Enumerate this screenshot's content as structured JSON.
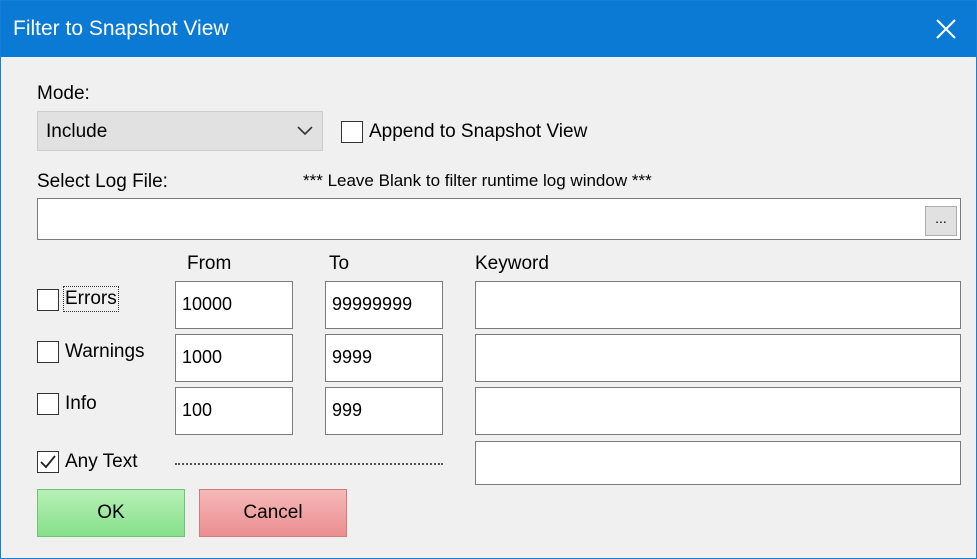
{
  "window": {
    "title": "Filter to Snapshot View",
    "close_glyph": "close-icon"
  },
  "mode": {
    "label": "Mode:",
    "selected": "Include",
    "append_label": "Append to Snapshot View",
    "append_checked": false
  },
  "log_file": {
    "label": "Select Log File:",
    "hint": "*** Leave Blank to filter runtime log window ***",
    "value": "",
    "browse_label": "..."
  },
  "columns": {
    "from": "From",
    "to": "To",
    "keyword": "Keyword"
  },
  "filters": [
    {
      "label": "Errors",
      "checked": false,
      "from": "10000",
      "to": "99999999",
      "keyword": ""
    },
    {
      "label": "Warnings",
      "checked": false,
      "from": "1000",
      "to": "9999",
      "keyword": ""
    },
    {
      "label": "Info",
      "checked": false,
      "from": "100",
      "to": "999",
      "keyword": ""
    }
  ],
  "any_text": {
    "label": "Any Text",
    "checked": true,
    "keyword": ""
  },
  "buttons": {
    "ok": "OK",
    "cancel": "Cancel"
  },
  "colors": {
    "titlebar": "#0a7ad4",
    "ok_button": "#86e08a",
    "cancel_button": "#eb8e90"
  }
}
